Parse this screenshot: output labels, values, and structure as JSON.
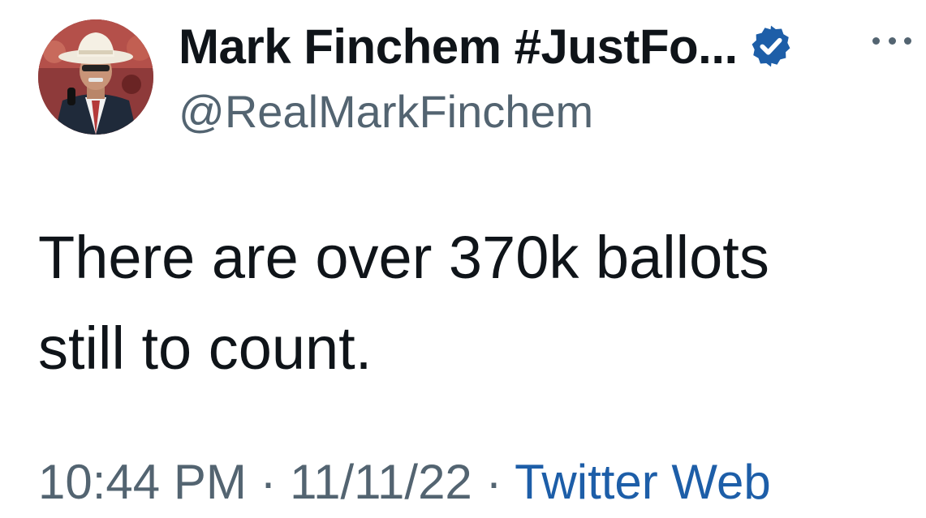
{
  "user": {
    "display_name": "Mark Finchem #JustFo...",
    "handle": "@RealMarkFinchem",
    "avatar_icon": "profile-photo",
    "verified_icon": "verified-badge-icon",
    "verified_color": "#1d5ea8"
  },
  "more_icon": "more-options-icon",
  "tweet": {
    "line1": "There are over 370k ballots",
    "line2": "still to count."
  },
  "meta": {
    "time": "10:44 PM",
    "sep1": " · ",
    "date": "11/11/22",
    "sep2": " · ",
    "source": "Twitter Web"
  },
  "colors": {
    "text": "#0f1419",
    "secondary": "#536471",
    "link": "#1d5ea8"
  }
}
